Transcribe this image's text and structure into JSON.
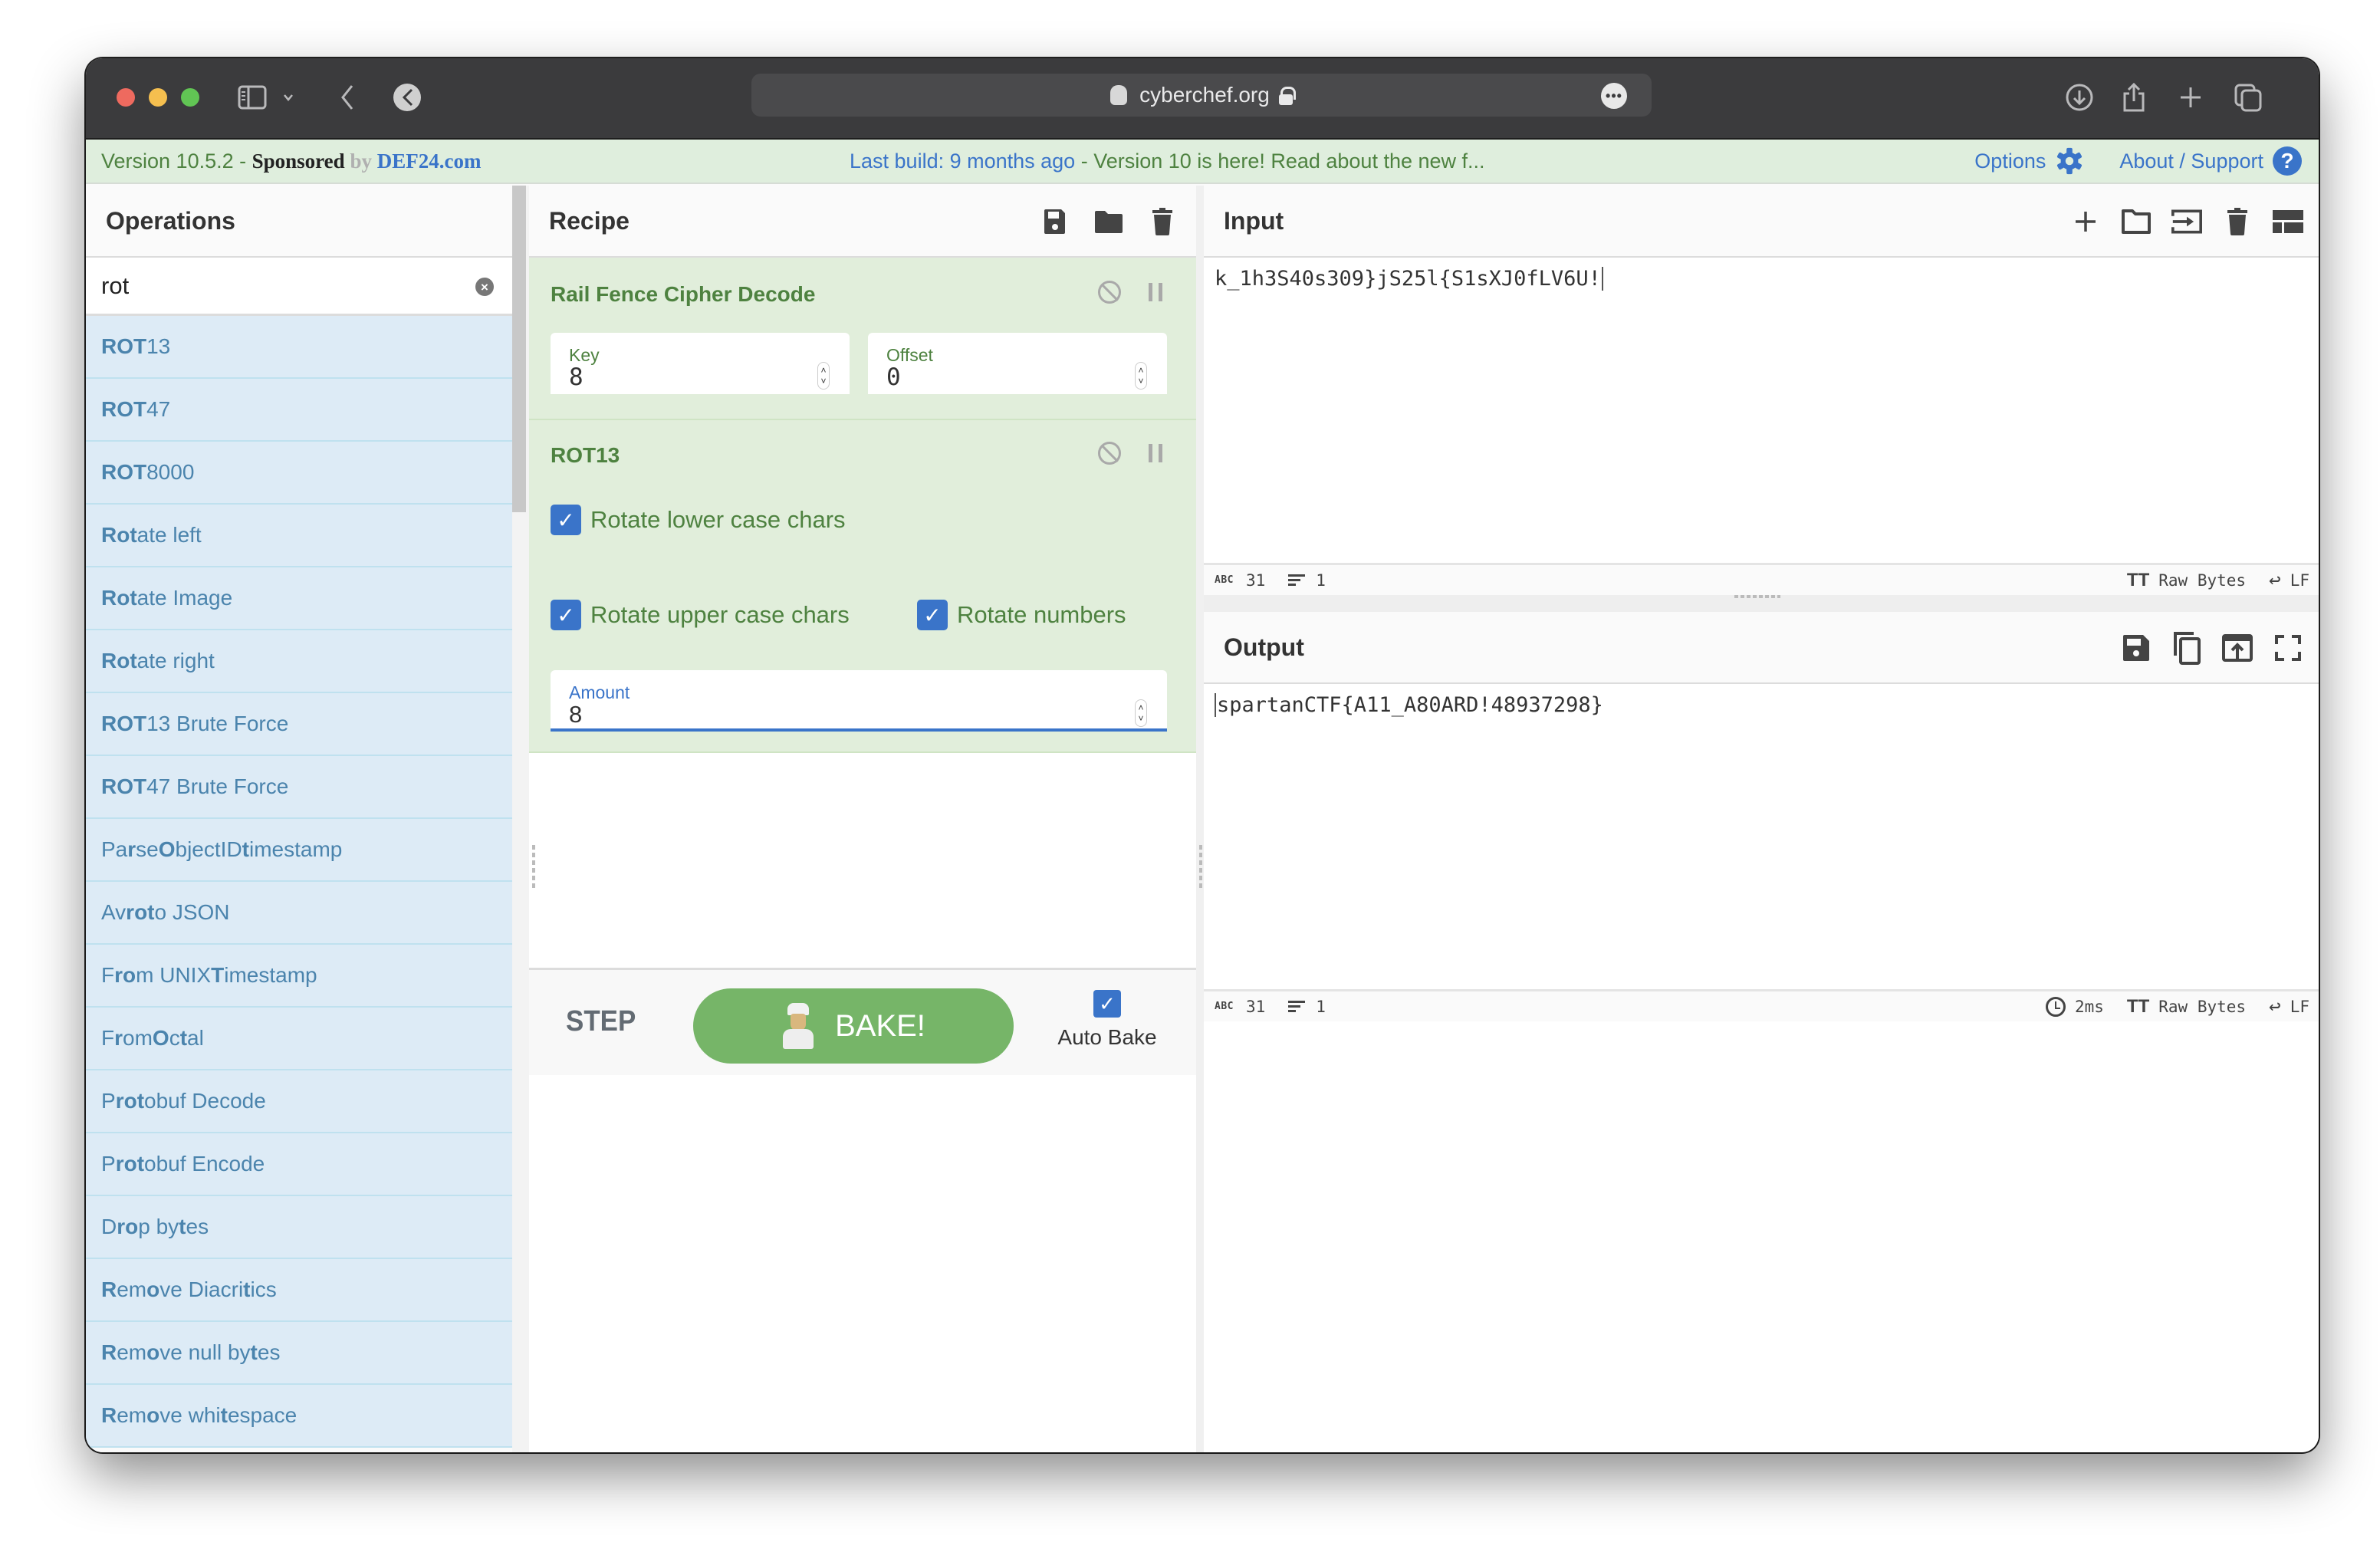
{
  "browser": {
    "url": "cyberchef.org",
    "icons": [
      "sidebar-toggle-icon",
      "chevron-down-icon",
      "back-icon",
      "extension-icon",
      "more-icon",
      "download-icon",
      "share-icon",
      "new-tab-icon",
      "tabs-overview-icon"
    ]
  },
  "banner": {
    "version": "Version 10.5.2 - ",
    "sponsored": "Sponsored",
    "sponsored_faded": " by ",
    "sponsor": "DEF24.com",
    "last_build": "Last build: 9 months ago",
    "separator": " - ",
    "news": "Version 10 is here! Read about the new f...",
    "options": "Options",
    "about": "About / Support",
    "help_glyph": "?"
  },
  "operations": {
    "title": "Operations",
    "search_value": "rot",
    "clear_glyph": "×",
    "items": [
      {
        "segments": [
          {
            "t": "ROT",
            "b": true
          },
          {
            "t": "13",
            "b": false
          }
        ]
      },
      {
        "segments": [
          {
            "t": "ROT",
            "b": true
          },
          {
            "t": "47",
            "b": false
          }
        ]
      },
      {
        "segments": [
          {
            "t": "ROT",
            "b": true
          },
          {
            "t": "8000",
            "b": false
          }
        ]
      },
      {
        "segments": [
          {
            "t": "Rot",
            "b": true
          },
          {
            "t": "ate left",
            "b": false
          }
        ]
      },
      {
        "segments": [
          {
            "t": "Rot",
            "b": true
          },
          {
            "t": "ate Image",
            "b": false
          }
        ]
      },
      {
        "segments": [
          {
            "t": "Rot",
            "b": true
          },
          {
            "t": "ate right",
            "b": false
          }
        ]
      },
      {
        "segments": [
          {
            "t": "ROT",
            "b": true
          },
          {
            "t": "13 Brute Force",
            "b": false
          }
        ]
      },
      {
        "segments": [
          {
            "t": "ROT",
            "b": true
          },
          {
            "t": "47 Brute Force",
            "b": false
          }
        ]
      },
      {
        "segments": [
          {
            "t": "Pa",
            "b": false
          },
          {
            "t": "r",
            "b": true
          },
          {
            "t": "se ",
            "b": false
          },
          {
            "t": "O",
            "b": true
          },
          {
            "t": "bjectID ",
            "b": false
          },
          {
            "t": "t",
            "b": true
          },
          {
            "t": "imestamp",
            "b": false
          }
        ]
      },
      {
        "segments": [
          {
            "t": "Av",
            "b": false
          },
          {
            "t": "ro",
            "b": true
          },
          {
            "t": " ",
            "b": false
          },
          {
            "t": "t",
            "b": true
          },
          {
            "t": "o JSON",
            "b": false
          }
        ]
      },
      {
        "segments": [
          {
            "t": "F",
            "b": false
          },
          {
            "t": "ro",
            "b": true
          },
          {
            "t": "m UNIX ",
            "b": false
          },
          {
            "t": "T",
            "b": true
          },
          {
            "t": "imestamp",
            "b": false
          }
        ]
      },
      {
        "segments": [
          {
            "t": "F",
            "b": false
          },
          {
            "t": "r",
            "b": true
          },
          {
            "t": "om ",
            "b": false
          },
          {
            "t": "O",
            "b": true
          },
          {
            "t": "c",
            "b": false
          },
          {
            "t": "t",
            "b": true
          },
          {
            "t": "al",
            "b": false
          }
        ]
      },
      {
        "segments": [
          {
            "t": "P",
            "b": false
          },
          {
            "t": "rot",
            "b": true
          },
          {
            "t": "obuf Decode",
            "b": false
          }
        ]
      },
      {
        "segments": [
          {
            "t": "P",
            "b": false
          },
          {
            "t": "rot",
            "b": true
          },
          {
            "t": "obuf Encode",
            "b": false
          }
        ]
      },
      {
        "segments": [
          {
            "t": "D",
            "b": false
          },
          {
            "t": "ro",
            "b": true
          },
          {
            "t": "p by",
            "b": false
          },
          {
            "t": "t",
            "b": true
          },
          {
            "t": "es",
            "b": false
          }
        ]
      },
      {
        "segments": [
          {
            "t": "R",
            "b": true
          },
          {
            "t": "em",
            "b": false
          },
          {
            "t": "o",
            "b": true
          },
          {
            "t": "ve Diacri",
            "b": false
          },
          {
            "t": "t",
            "b": true
          },
          {
            "t": "ics",
            "b": false
          }
        ]
      },
      {
        "segments": [
          {
            "t": "R",
            "b": true
          },
          {
            "t": "em",
            "b": false
          },
          {
            "t": "o",
            "b": true
          },
          {
            "t": "ve null by",
            "b": false
          },
          {
            "t": "t",
            "b": true
          },
          {
            "t": "es",
            "b": false
          }
        ]
      },
      {
        "segments": [
          {
            "t": "R",
            "b": true
          },
          {
            "t": "em",
            "b": false
          },
          {
            "t": "o",
            "b": true
          },
          {
            "t": "ve whi",
            "b": false
          },
          {
            "t": "t",
            "b": true
          },
          {
            "t": "espace",
            "b": false
          }
        ]
      }
    ]
  },
  "recipe": {
    "title": "Recipe",
    "ingredients": [
      {
        "name": "Rail Fence Cipher Decode",
        "fields": [
          {
            "label": "Key",
            "value": "8"
          },
          {
            "label": "Offset",
            "value": "0"
          }
        ]
      },
      {
        "name": "ROT13",
        "checkboxes": [
          {
            "label": "Rotate lower case chars",
            "checked": true
          },
          {
            "label": "Rotate upper case chars",
            "checked": true
          },
          {
            "label": "Rotate numbers",
            "checked": true
          }
        ],
        "amount": {
          "label": "Amount",
          "value": "8"
        }
      }
    ],
    "step_label": "STEP",
    "bake_label": "BAKE!",
    "auto_bake_label": "Auto Bake",
    "auto_bake_checked": true,
    "check_glyph": "✓"
  },
  "input": {
    "title": "Input",
    "value": "k_1h3S40s309}jS25l{S1sXJ0fLV6U!",
    "status": {
      "abc_label": "ABC",
      "chars": "31",
      "lines": "1",
      "encoding": "Raw Bytes",
      "eol": "LF",
      "tt_glyph": "TT",
      "eol_glyph": "↩"
    }
  },
  "output": {
    "title": "Output",
    "value": "spartanCTF{A11_A80ARD!48937298}",
    "status": {
      "abc_label": "ABC",
      "chars": "31",
      "lines": "1",
      "time": "2ms",
      "encoding": "Raw Bytes",
      "eol": "LF",
      "tt_glyph": "TT",
      "eol_glyph": "↩"
    }
  },
  "colors": {
    "accent_blue": "#3a74c9",
    "recipe_green": "#4e8240",
    "bake_green": "#76b568",
    "op_item_bg": "#ddebf6",
    "banner_bg": "#dfeedd"
  }
}
